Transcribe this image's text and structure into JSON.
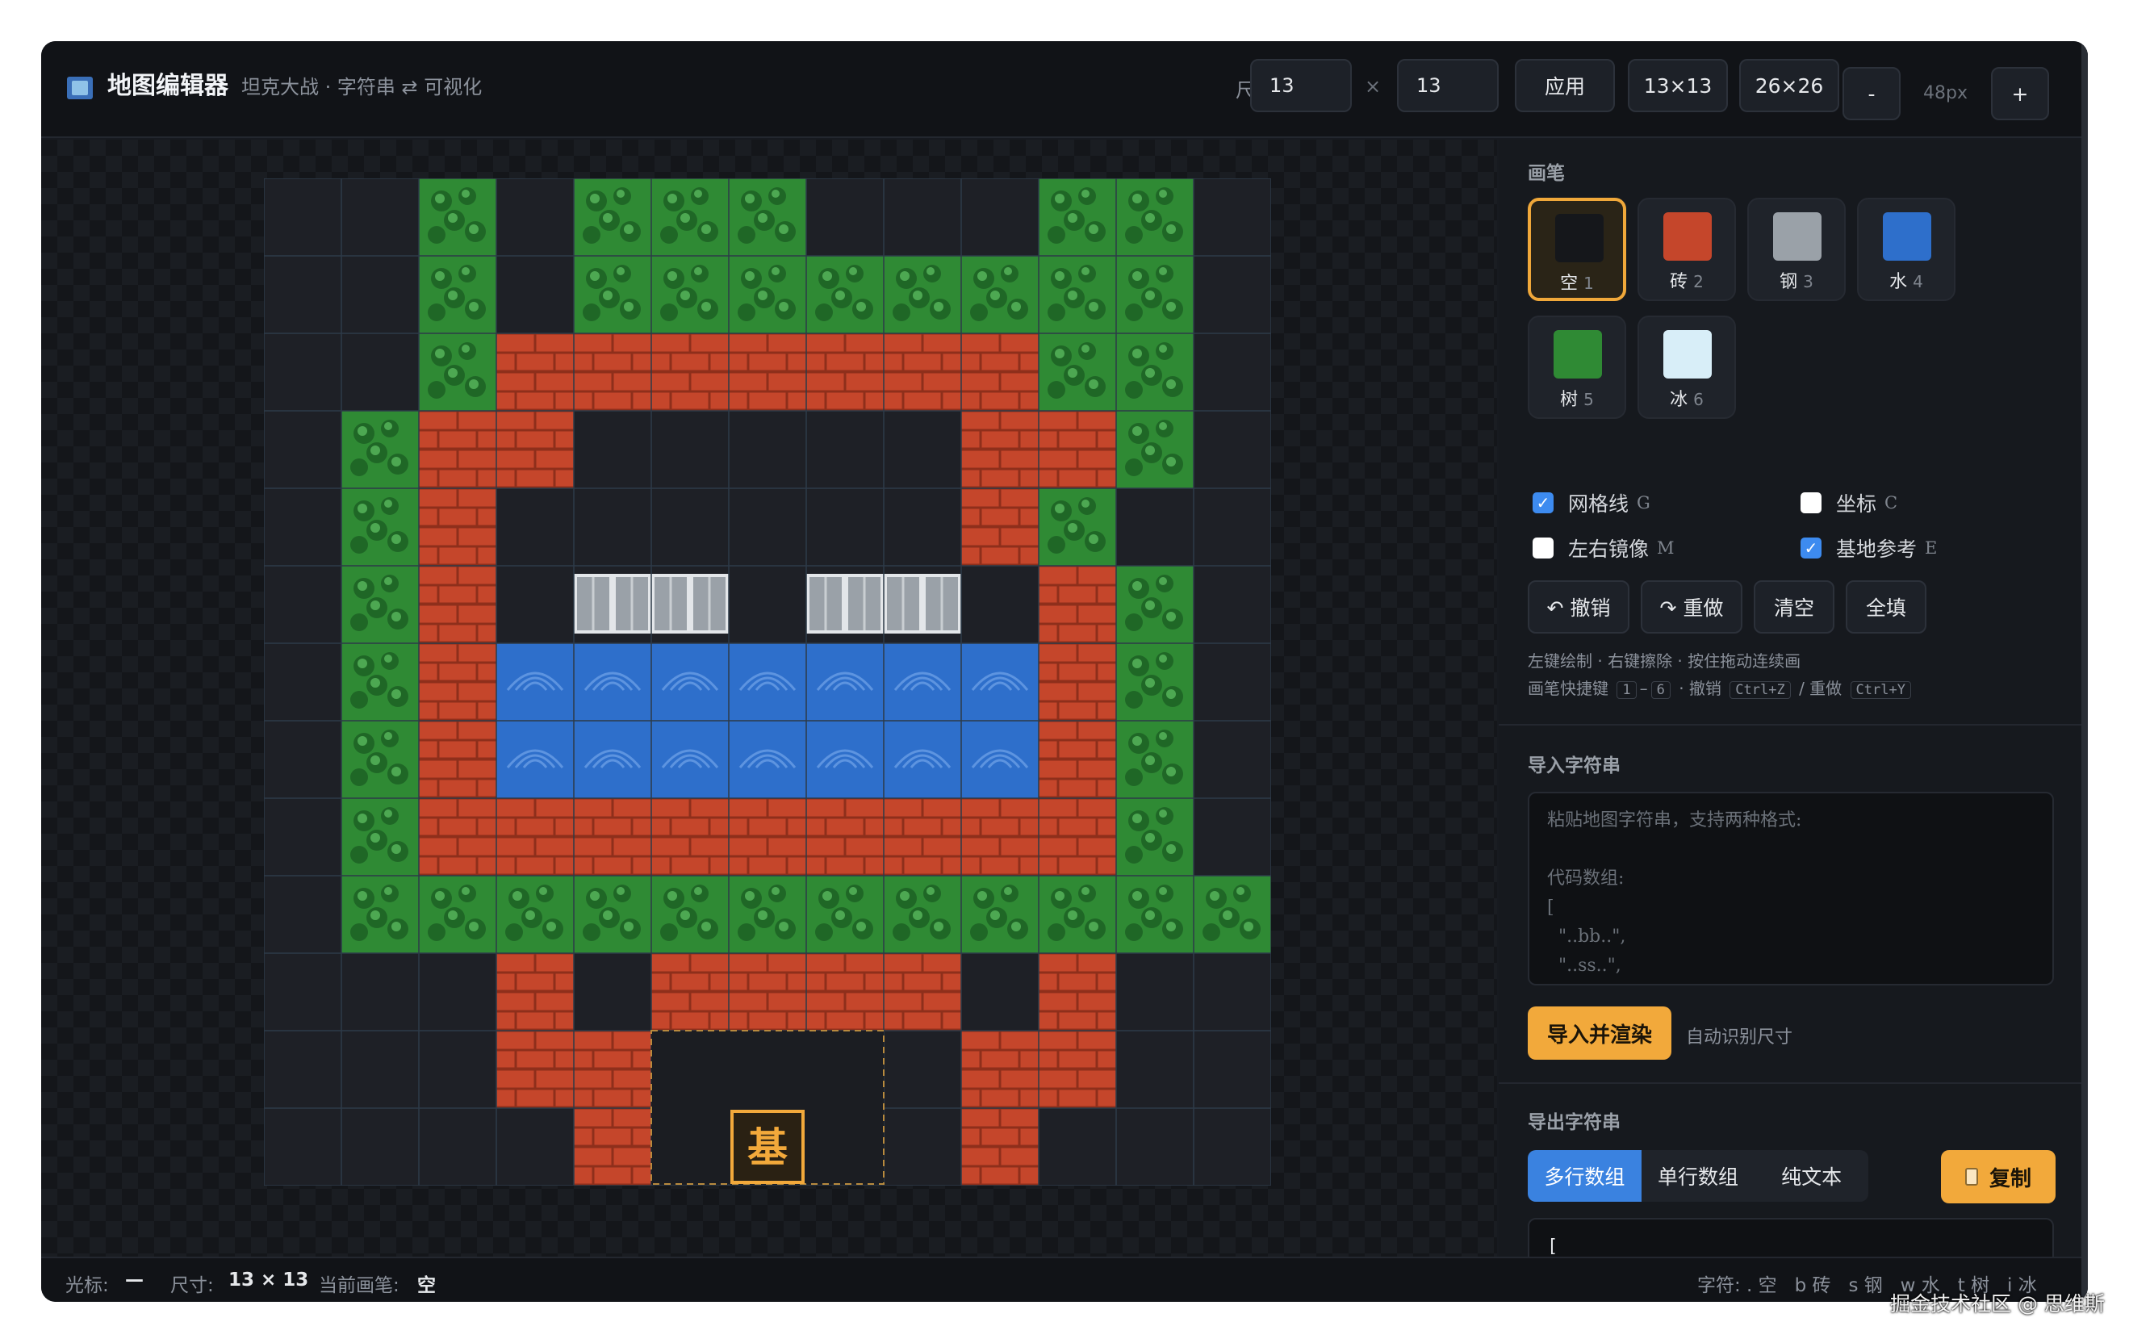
{
  "header": {
    "title": "地图编辑器",
    "subtitle": "坦克大战 · 字符串 ⇄ 可视化",
    "size_label": "尺寸",
    "width_value": "13",
    "times": "×",
    "height_value": "13",
    "apply_label": "应用",
    "preset_13": "13×13",
    "preset_26": "26×26",
    "zoom_out_label": "-",
    "zoom_value": "48px",
    "zoom_in_label": "+"
  },
  "colors": {
    "empty": "#1e2026",
    "brick": "#c5462b",
    "steel": "#9aa1a8",
    "water": "#2e6fcb",
    "tree": "#2f8a34",
    "ice": "#d8eef8",
    "accent": "#f2a93b",
    "grid_line": "#2d3a48"
  },
  "map": {
    "rows": [
      "..t.ttt...tt.",
      "..t.tttttttt.",
      "..tbbbbbbbtt.",
      ".tbb.....bbt.",
      ".tb......bt.",
      ".tb.ss.ss.bt.",
      ".tbwwwwwwwbt.",
      ".tbwwwwwwwbt.",
      ".tbbbbbbbbbt.",
      ".tttttttttttt",
      "...b.bbbb.b..",
      "...bb....bb..",
      "....b....b..."
    ],
    "base_label": "基"
  },
  "brush": {
    "section_label": "画笔",
    "items": [
      {
        "name": "空",
        "key": "1",
        "color": "#15171b",
        "selected": true
      },
      {
        "name": "砖",
        "key": "2",
        "color": "#c5462b",
        "selected": false
      },
      {
        "name": "钢",
        "key": "3",
        "color": "#9aa1a8",
        "selected": false
      },
      {
        "name": "水",
        "key": "4",
        "color": "#2e6fcb",
        "selected": false
      },
      {
        "name": "树",
        "key": "5",
        "color": "#2f8a34",
        "selected": false
      },
      {
        "name": "冰",
        "key": "6",
        "color": "#d8eef8",
        "selected": false
      }
    ]
  },
  "options": {
    "gridlines": {
      "label": "网格线",
      "key": "G",
      "checked": true
    },
    "coords": {
      "label": "坐标",
      "key": "C",
      "checked": false
    },
    "mirror": {
      "label": "左右镜像",
      "key": "M",
      "checked": false
    },
    "base_ref": {
      "label": "基地参考",
      "key": "E",
      "checked": true
    }
  },
  "actions": {
    "undo": "↶ 撤销",
    "redo": "↷ 重做",
    "clear": "清空",
    "fill": "全填"
  },
  "hints": {
    "line1": "左键绘制 · 右键擦除 · 按住拖动连续画",
    "line2_prefix": "画笔快捷键",
    "key_1": "1",
    "dash": "–",
    "key_6": "6",
    "undo_text": "· 撤销",
    "undo_key": "Ctrl+Z",
    "redo_text": "/ 重做",
    "redo_key": "Ctrl+Y"
  },
  "import": {
    "section_label": "导入字符串",
    "placeholder": "粘贴地图字符串，支持两种格式:\n\n代码数组:\n[\n  \"..bb..\",\n  \"..ss..\",",
    "button": "导入并渲染",
    "auto_label": "自动识别尺寸"
  },
  "export": {
    "section_label": "导出字符串",
    "tabs": [
      "多行数组",
      "单行数组",
      "纯文本"
    ],
    "active_tab": 0,
    "copy_label": "复制",
    "content": "[\n  \"..t.ttt...tt.\","
  },
  "status": {
    "cursor_label": "光标:",
    "cursor_value": "—",
    "size_label": "尺寸:",
    "size_value": "13 × 13",
    "brush_label": "当前画笔:",
    "brush_value": "空",
    "legend": "字符: . 空   b 砖   s 钢   w 水   t 树   i 冰"
  },
  "watermark": "掘金技术社区 @ 思维斯"
}
